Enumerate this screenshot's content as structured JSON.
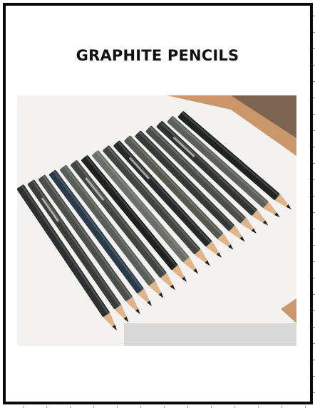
{
  "document": {
    "title": "GRAPHITE PENCILS"
  },
  "photo": {
    "icon": "pencils-photo",
    "pencil_colors": [
      "#2c3030",
      "#3a3d3a",
      "#4b4f4c",
      "#2b3a4a",
      "#5a5e58",
      "#3f4541",
      "#1e2120",
      "#6a6f68",
      "#404542",
      "#26292a",
      "#55594f",
      "#343836",
      "#4a4e4a",
      "#2f3331",
      "#5c5f5a",
      "#1f2322"
    ],
    "wood_color": "#e0b48a",
    "graphite_color": "#222222"
  }
}
